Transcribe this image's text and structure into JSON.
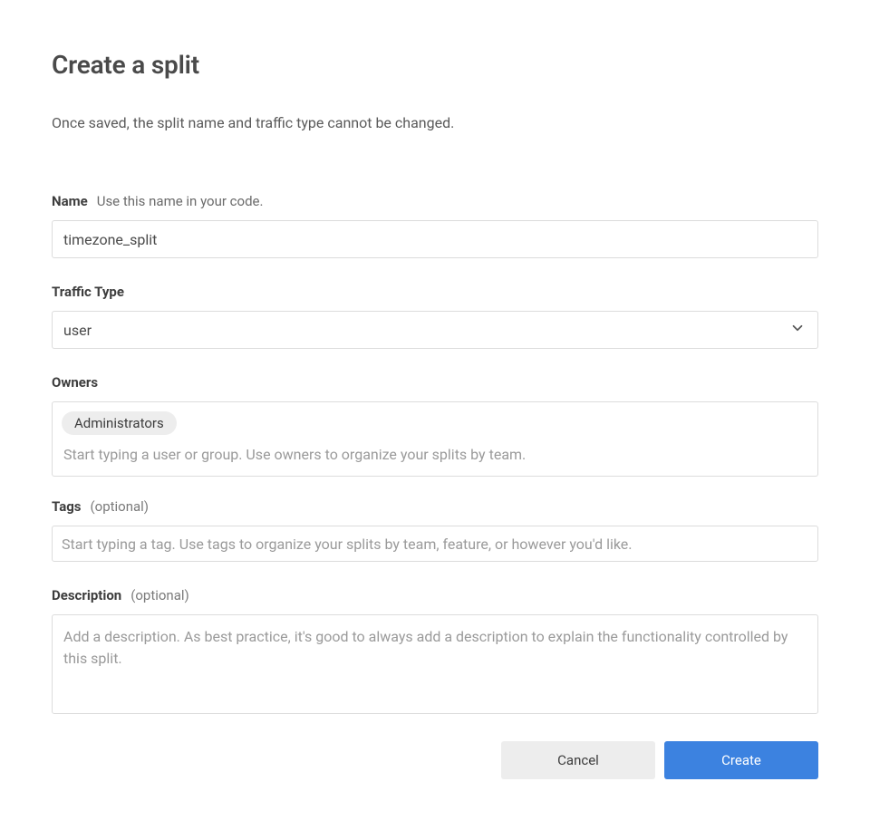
{
  "header": {
    "title": "Create a split",
    "subtitle": "Once saved, the split name and traffic type cannot be changed."
  },
  "fields": {
    "name": {
      "label": "Name",
      "hint": "Use this name in your code.",
      "value": "timezone_split"
    },
    "traffic_type": {
      "label": "Traffic Type",
      "value": "user"
    },
    "owners": {
      "label": "Owners",
      "chips": [
        "Administrators"
      ],
      "placeholder": "Start typing a user or group. Use owners to organize your splits by team."
    },
    "tags": {
      "label": "Tags",
      "optional": "(optional)",
      "placeholder": "Start typing a tag. Use tags to organize your splits by team, feature, or however you'd like."
    },
    "description": {
      "label": "Description",
      "optional": "(optional)",
      "placeholder": "Add a description. As best practice, it's good to always add a description to explain the functionality controlled by this split."
    }
  },
  "buttons": {
    "cancel": "Cancel",
    "create": "Create"
  }
}
